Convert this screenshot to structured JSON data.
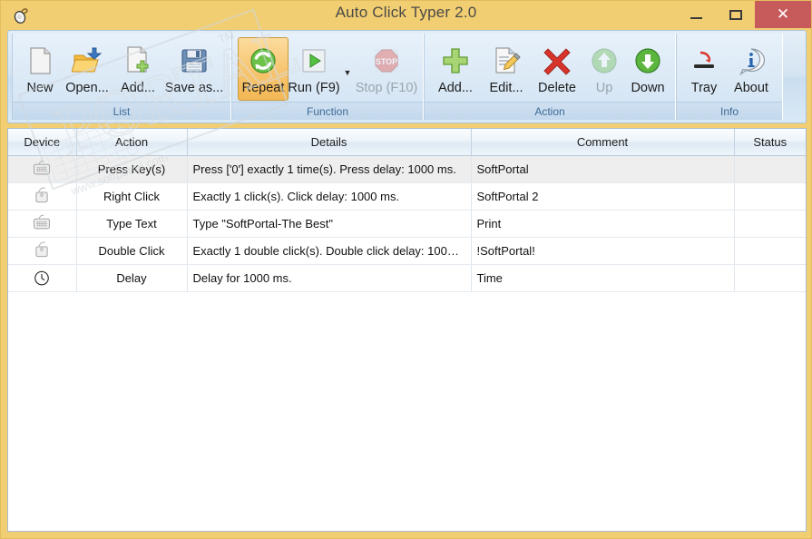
{
  "window": {
    "title": "Auto Click Typer 2.0",
    "app_icon": "mouse-cursor-icon",
    "minimize_label": "",
    "maximize_label": "",
    "close_label": "✕",
    "frame_color": "#f2ce72",
    "close_button_color": "#c75b5b"
  },
  "ribbon": {
    "groups": [
      {
        "label": "List",
        "buttons": [
          {
            "label": "New",
            "icon": "new-document-icon",
            "state": "enabled"
          },
          {
            "label": "Open...",
            "icon": "open-folder-icon",
            "state": "enabled"
          },
          {
            "label": "Add...",
            "icon": "add-document-icon",
            "state": "enabled"
          },
          {
            "label": "Save as...",
            "icon": "save-floppy-icon",
            "state": "enabled"
          }
        ]
      },
      {
        "label": "Function",
        "buttons": [
          {
            "label": "Repeat",
            "icon": "repeat-refresh-icon",
            "state": "active"
          },
          {
            "label": "Run (F9)",
            "icon": "play-triangle-icon",
            "state": "enabled",
            "has_dropdown": true
          },
          {
            "label": "Stop (F10)",
            "icon": "stop-sign-icon",
            "state": "disabled"
          }
        ]
      },
      {
        "label": "Action",
        "buttons": [
          {
            "label": "Add...",
            "icon": "plus-green-icon",
            "state": "enabled"
          },
          {
            "label": "Edit...",
            "icon": "edit-pencil-icon",
            "state": "enabled"
          },
          {
            "label": "Delete",
            "icon": "red-x-icon",
            "state": "enabled"
          },
          {
            "label": "Up",
            "icon": "arrow-up-green-icon",
            "state": "disabled"
          },
          {
            "label": "Down",
            "icon": "arrow-down-green-icon",
            "state": "enabled"
          }
        ]
      },
      {
        "label": "Info",
        "buttons": [
          {
            "label": "Tray",
            "icon": "minimize-to-tray-icon",
            "state": "enabled"
          },
          {
            "label": "About",
            "icon": "info-bubble-icon",
            "state": "enabled"
          }
        ]
      }
    ]
  },
  "list": {
    "columns": [
      "Device",
      "Action",
      "Details",
      "Comment",
      "Status"
    ],
    "rows": [
      {
        "device_icon": "keyboard-icon",
        "action": "Press Key(s)",
        "details": "Press ['0'] exactly 1 time(s). Press delay: 1000 ms.",
        "comment": "SoftPortal",
        "status": "",
        "selected": true
      },
      {
        "device_icon": "mouse-icon",
        "action": "Right Click",
        "details": "Exactly 1 click(s). Click delay: 1000 ms.",
        "comment": "SoftPortal 2",
        "status": "",
        "selected": false
      },
      {
        "device_icon": "keyboard-icon",
        "action": "Type Text",
        "details": "Type \"SoftPortal-The Best\"",
        "comment": "Print",
        "status": "",
        "selected": false
      },
      {
        "device_icon": "mouse-icon",
        "action": "Double Click",
        "details": "Exactly 1 double click(s). Double click delay: 100…",
        "comment": "!SoftPortal!",
        "status": "",
        "selected": false
      },
      {
        "device_icon": "clock-icon",
        "action": "Delay",
        "details": "Delay for 1000 ms.",
        "comment": "Time",
        "status": "",
        "selected": false
      }
    ]
  }
}
